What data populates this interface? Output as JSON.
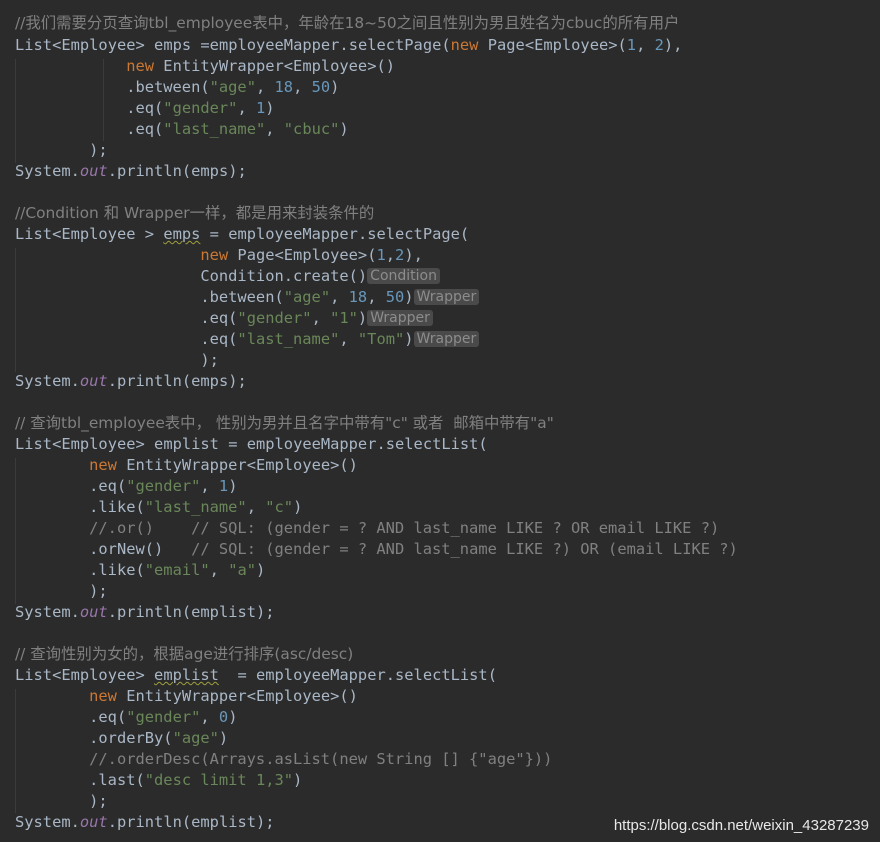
{
  "comments": {
    "c1": "//我们需要分页查询tbl_employee表中，年龄在18~50之间且性别为男且姓名为cbuc的所有用户",
    "c2": "//Condition 和 Wrapper一样，都是用来封装条件的",
    "c3": "// 查询tbl_employee表中， 性别为男并且名字中带有\"c\" 或者  邮箱中带有\"a\"",
    "c4": "// 查询性别为女的，根据age进行排序(asc/desc)",
    "or_comment": "//.or()    // SQL: (gender = ? AND last_name LIKE ? OR email LIKE ?)",
    "ornew_comment": "// SQL: (gender = ? AND last_name LIKE ?) OR (email LIKE ?)",
    "orderdesc_comment": "//.orderDesc(Arrays.asList(new String [] {\"age\"}))"
  },
  "tokens": {
    "List": "List",
    "Employee": "Employee",
    "emps": "emps",
    "emplist": "emplist",
    "employeeMapper": "employeeMapper",
    "selectPage": "selectPage",
    "selectList": "selectList",
    "new": "new",
    "Page": "Page",
    "EntityWrapper": "EntityWrapper",
    "Condition": "Condition",
    "create": "create",
    "between": "between",
    "eq": "eq",
    "like": "like",
    "orNew": "orNew",
    "orderBy": "orderBy",
    "last": "last",
    "System": "System",
    "out": "out",
    "println": "println"
  },
  "strings": {
    "age": "\"age\"",
    "gender": "\"gender\"",
    "last_name": "\"last_name\"",
    "cbuc": "\"cbuc\"",
    "one_str": "\"1\"",
    "tom": "\"Tom\"",
    "c": "\"c\"",
    "email": "\"email\"",
    "a": "\"a\"",
    "desc": "\"desc limit 1,3\""
  },
  "numbers": {
    "n1": "1",
    "n2": "2",
    "n18": "18",
    "n50": "50",
    "n0": "0"
  },
  "hints": {
    "condition": "Condition",
    "wrapper": "Wrapper"
  },
  "watermark": "https://blog.csdn.net/weixin_43287239"
}
